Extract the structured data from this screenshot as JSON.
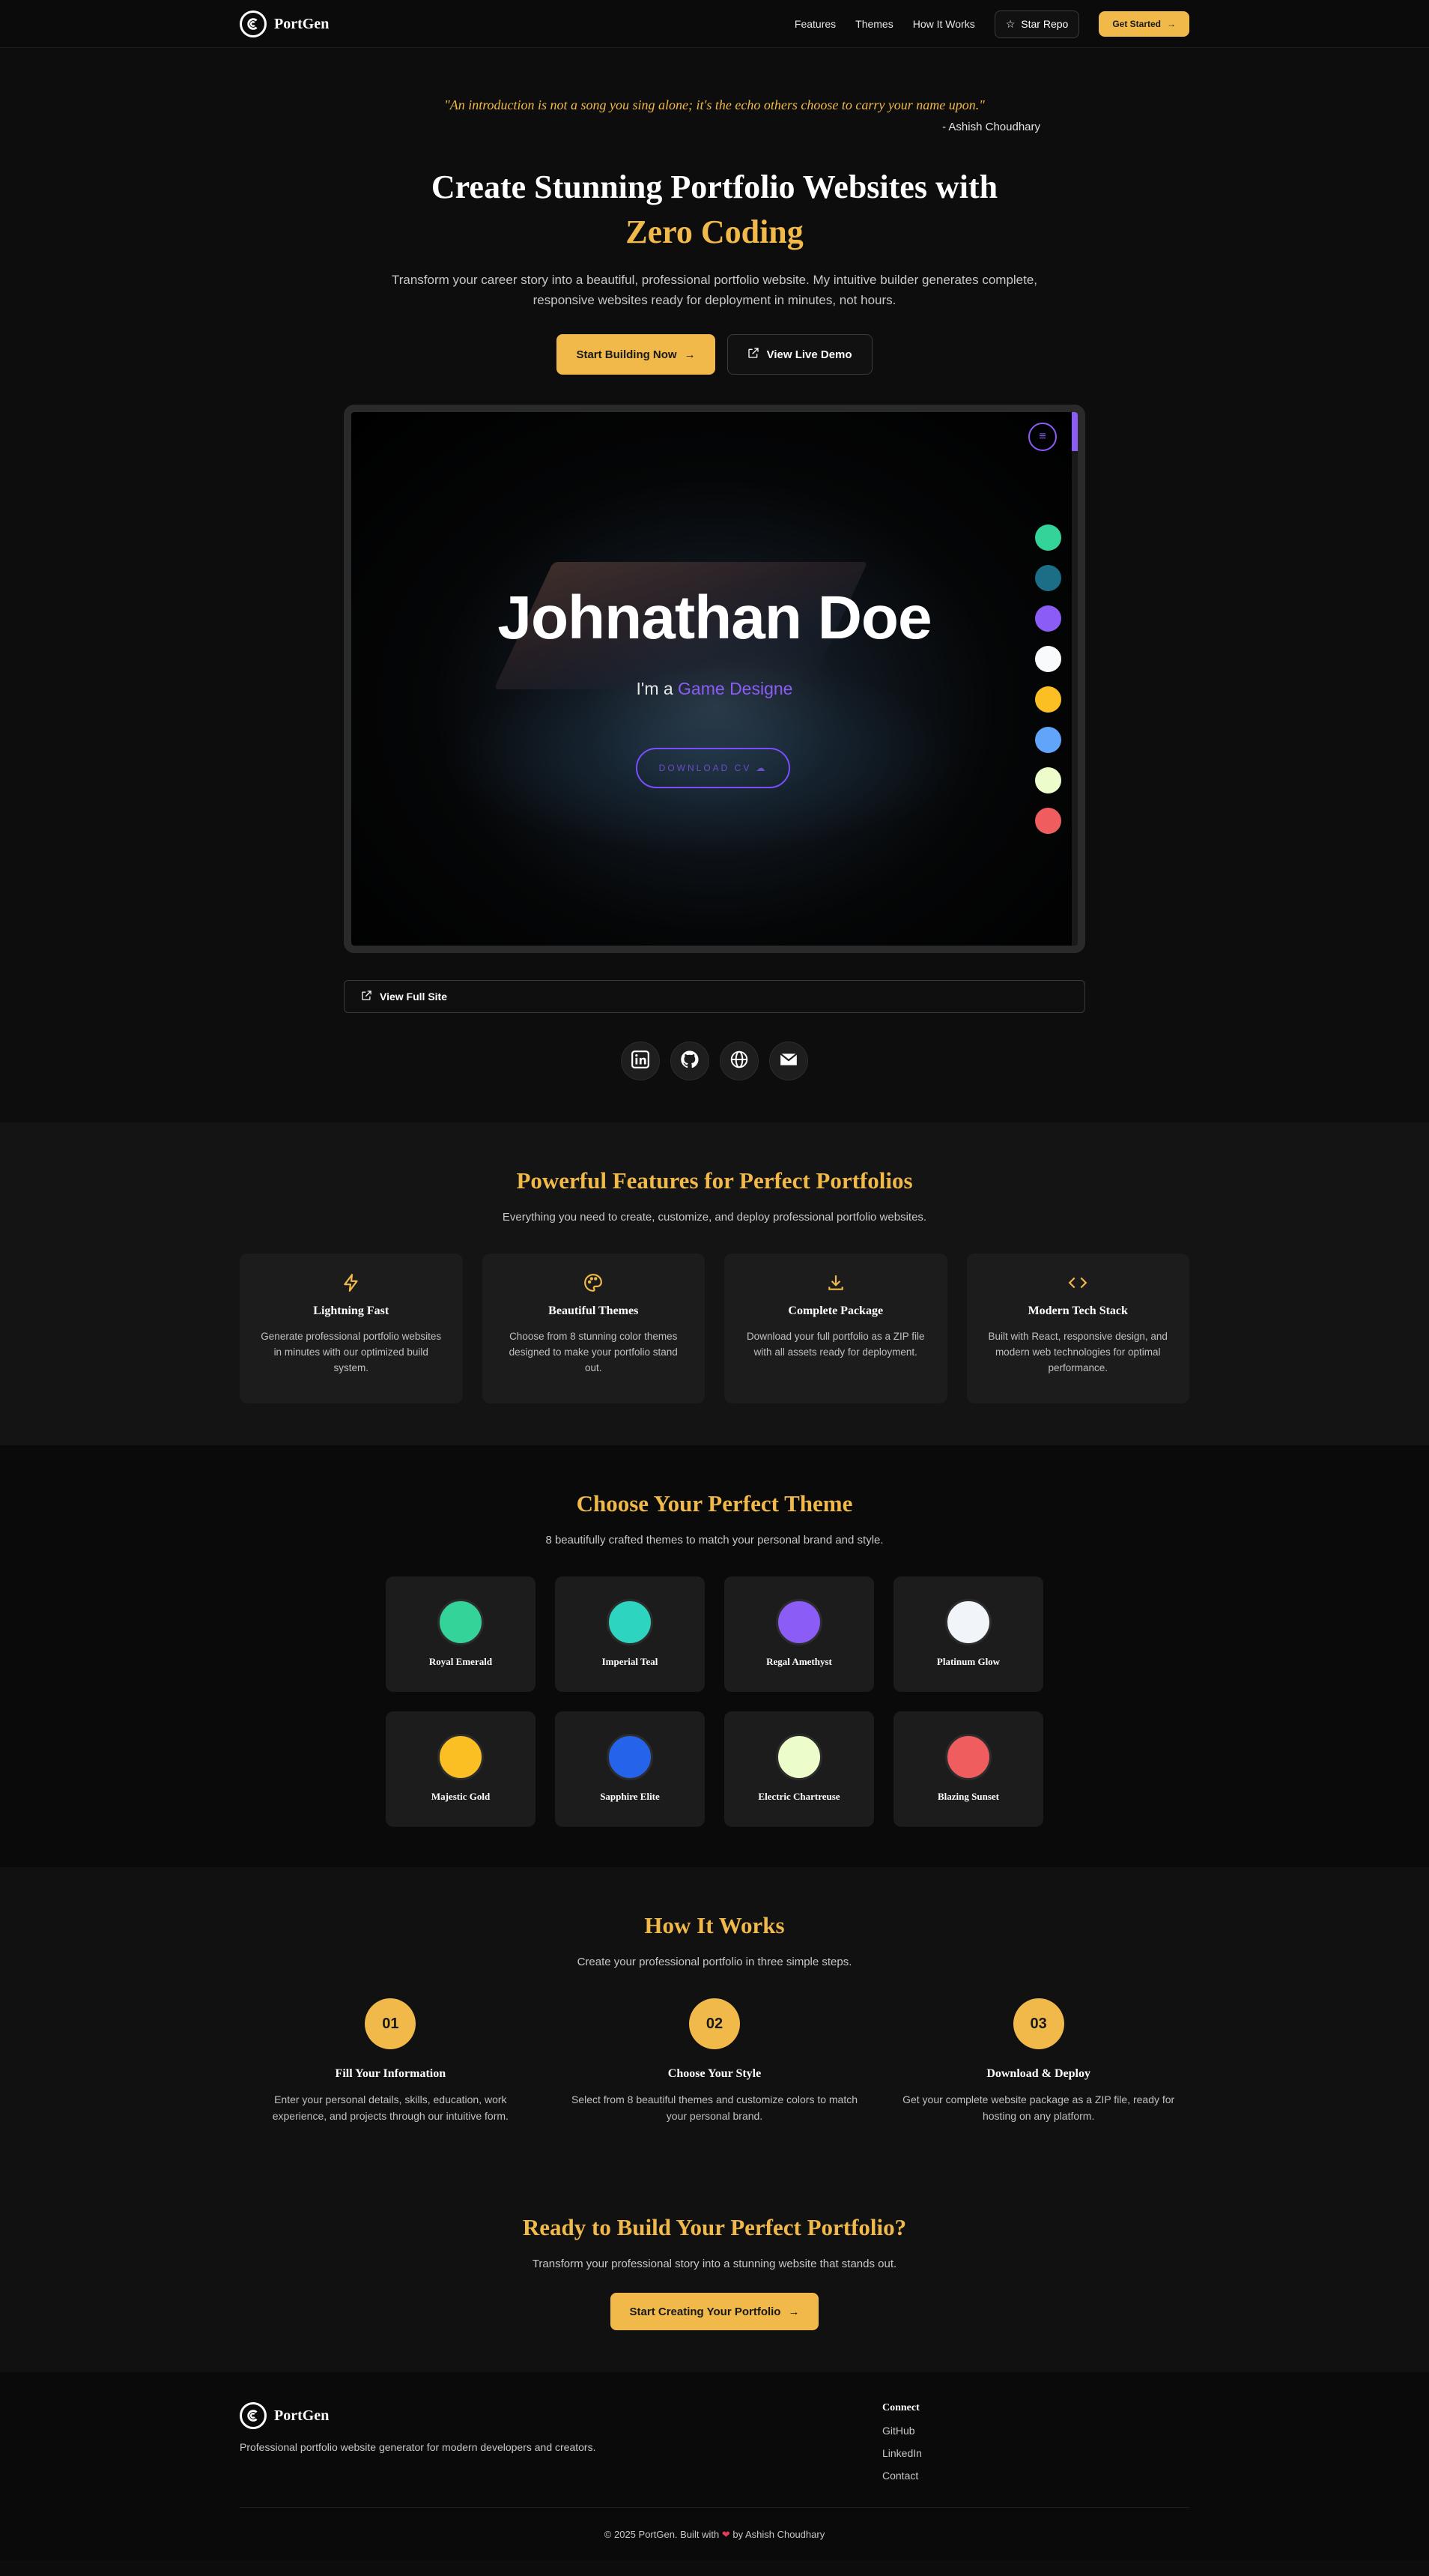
{
  "nav": {
    "brand": "PortGen",
    "links": [
      "Features",
      "Themes",
      "How It Works"
    ],
    "star_repo": "Star Repo",
    "get_started": "Get Started"
  },
  "hero": {
    "quote": "\"An introduction is not a song you sing alone; it's the echo others choose to carry your name upon.\"",
    "quote_author": "- Ashish Choudhary",
    "title_line1": "Create Stunning Portfolio Websites with",
    "title_line2": "Zero Coding",
    "subtitle": "Transform your career story into a beautiful, professional portfolio website. My intuitive builder generates complete, responsive websites ready for deployment in minutes, not hours.",
    "primary_button": "Start Building Now",
    "secondary_button": "View Live Demo"
  },
  "preview": {
    "name": "Johnathan Doe",
    "role_prefix": "I'm a",
    "role_highlight": "Game Designe",
    "cv_button": "DOWNLOAD CV",
    "swatches": [
      "#34d399",
      "#1b6e86",
      "#8b5cf6",
      "#f8fafc",
      "#fbbf24",
      "#60a5fa",
      "#ecfccb",
      "#f05d5e"
    ],
    "view_full": "View Full Site"
  },
  "socials": [
    "linkedin-icon",
    "github-icon",
    "globe-icon",
    "mail-icon"
  ],
  "features": {
    "title": "Powerful Features for Perfect Portfolios",
    "subtitle": "Everything you need to create, customize, and deploy professional portfolio websites.",
    "items": [
      {
        "icon": "lightning-icon",
        "title": "Lightning Fast",
        "desc": "Generate professional portfolio websites in minutes with our optimized build system."
      },
      {
        "icon": "palette-icon",
        "title": "Beautiful Themes",
        "desc": "Choose from 8 stunning color themes designed to make your portfolio stand out."
      },
      {
        "icon": "download-icon",
        "title": "Complete Package",
        "desc": "Download your full portfolio as a ZIP file with all assets ready for deployment."
      },
      {
        "icon": "code-icon",
        "title": "Modern Tech Stack",
        "desc": "Built with React, responsive design, and modern web technologies for optimal performance."
      }
    ]
  },
  "themes": {
    "title": "Choose Your Perfect Theme",
    "subtitle": "8 beautifully crafted themes to match your personal brand and style.",
    "items": [
      {
        "name": "Royal Emerald",
        "color": "#34d399"
      },
      {
        "name": "Imperial Teal",
        "color": "#2dd4bf"
      },
      {
        "name": "Regal Amethyst",
        "color": "#8b5cf6"
      },
      {
        "name": "Platinum Glow",
        "color": "#f1f5f9"
      },
      {
        "name": "Majestic Gold",
        "color": "#fbbf24"
      },
      {
        "name": "Sapphire Elite",
        "color": "#2563eb"
      },
      {
        "name": "Electric Chartreuse",
        "color": "#ecfccb"
      },
      {
        "name": "Blazing Sunset",
        "color": "#f05d5e"
      }
    ]
  },
  "how": {
    "title": "How It Works",
    "subtitle": "Create your professional portfolio in three simple steps.",
    "steps": [
      {
        "num": "01",
        "title": "Fill Your Information",
        "desc": "Enter your personal details, skills, education, work experience, and projects through our intuitive form."
      },
      {
        "num": "02",
        "title": "Choose Your Style",
        "desc": "Select from 8 beautiful themes and customize colors to match your personal brand."
      },
      {
        "num": "03",
        "title": "Download & Deploy",
        "desc": "Get your complete website package as a ZIP file, ready for hosting on any platform."
      }
    ]
  },
  "cta": {
    "title": "Ready to Build Your Perfect Portfolio?",
    "subtitle": "Transform your professional story into a stunning website that stands out.",
    "button": "Start Creating Your Portfolio"
  },
  "footer": {
    "brand": "PortGen",
    "tagline": "Professional portfolio website generator for modern developers and creators.",
    "connect_title": "Connect",
    "links": [
      "GitHub",
      "LinkedIn",
      "Contact"
    ],
    "copyright_prefix": "© 2025 PortGen. Built with",
    "copyright_suffix": "by Ashish Choudhary"
  }
}
